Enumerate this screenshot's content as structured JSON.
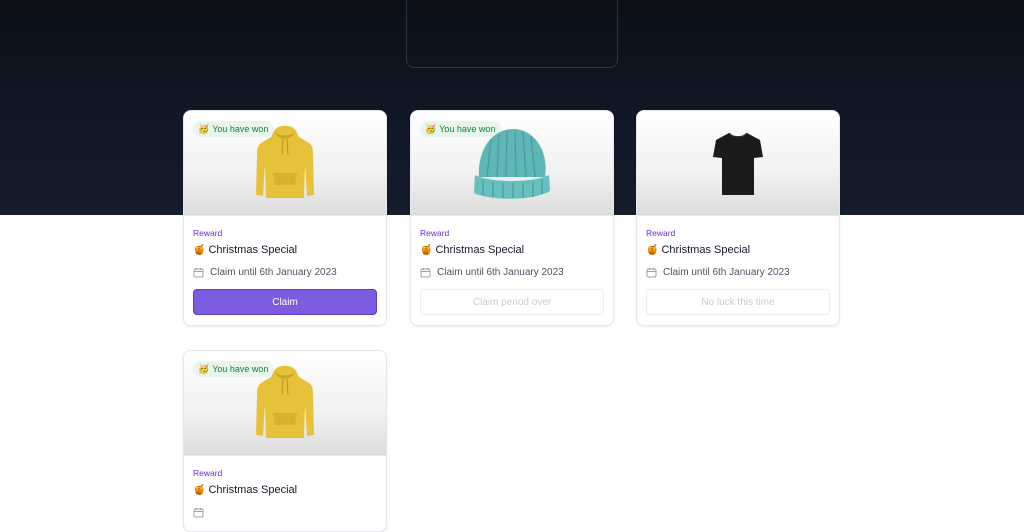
{
  "colors": {
    "accent": "#7c5ce0",
    "badge_bg": "#e7f6ea",
    "badge_text": "#15803d",
    "tag_text": "#6d28d9"
  },
  "cards": [
    {
      "badge": "You have won",
      "badge_emoji": "🥳",
      "product_icon": "hoodie-icon",
      "tag": "Reward",
      "title_emoji": "🍯",
      "title": "Christmas Special",
      "claim_text": "Claim until 6th January 2023",
      "button": "Claim",
      "button_state": "enabled"
    },
    {
      "badge": "You have won",
      "badge_emoji": "🥳",
      "product_icon": "beanie-icon",
      "tag": "Reward",
      "title_emoji": "🍯",
      "title": "Christmas Special",
      "claim_text": "Claim until 6th January 2023",
      "button": "Claim period over",
      "button_state": "disabled"
    },
    {
      "badge": "",
      "product_icon": "tshirt-icon",
      "tag": "Reward",
      "title_emoji": "🍯",
      "title": "Christmas Special",
      "claim_text": "Claim until 6th January 2023",
      "button": "No luck this time",
      "button_state": "disabled"
    },
    {
      "badge": "You have won",
      "badge_emoji": "🥳",
      "product_icon": "hoodie-icon",
      "tag": "Reward",
      "title_emoji": "🍯",
      "title": "Christmas Special"
    }
  ]
}
